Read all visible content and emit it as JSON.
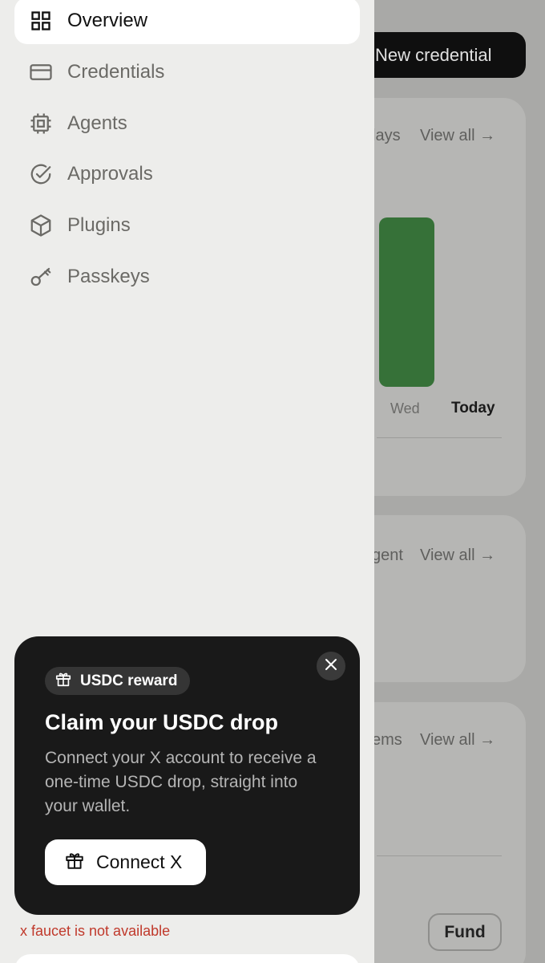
{
  "background": {
    "new_credential_label": "New credential",
    "card1": {
      "header_partial": "lays",
      "link": "View all →",
      "bar_day": "Wed",
      "today_label": "Today"
    },
    "card2": {
      "header_partial": "gent",
      "link": "View all →"
    },
    "card3": {
      "header_partial": "ems",
      "link": "View all →",
      "fund_label": "Fund"
    }
  },
  "sidebar": {
    "items": [
      {
        "label": "Overview",
        "icon": "grid-icon",
        "active": true
      },
      {
        "label": "Credentials",
        "icon": "card-icon",
        "active": false
      },
      {
        "label": "Agents",
        "icon": "chip-icon",
        "active": false
      },
      {
        "label": "Approvals",
        "icon": "check-circle-icon",
        "active": false
      },
      {
        "label": "Plugins",
        "icon": "cube-icon",
        "active": false
      },
      {
        "label": "Passkeys",
        "icon": "key-icon",
        "active": false
      }
    ]
  },
  "promo": {
    "badge": "USDC reward",
    "title": "Claim your USDC drop",
    "body": "Connect your X account to receive a one-time USDC drop, straight into your wallet.",
    "button": "Connect X"
  },
  "error": "x faucet is not available",
  "colors": {
    "accent_green": "#367138",
    "error_red": "#c0392b",
    "promo_bg": "#191919"
  }
}
